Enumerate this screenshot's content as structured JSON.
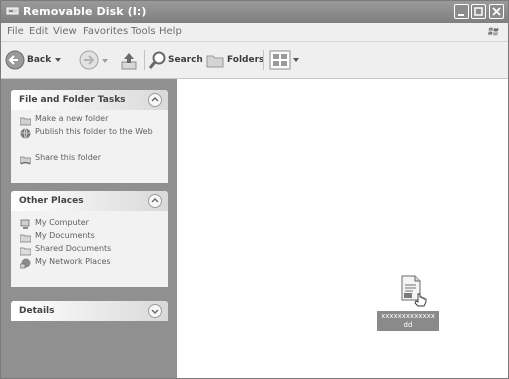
{
  "window": {
    "title": "Removable Disk (I:)"
  },
  "menu": {
    "items": [
      "File",
      "Edit",
      "View",
      "Favorites",
      "Tools",
      "Help"
    ]
  },
  "toolbar": {
    "back_label": "Back",
    "search_label": "Search",
    "folders_label": "Folders"
  },
  "tasks": {
    "title": "File and Folder Tasks",
    "items": [
      {
        "icon": "new-folder-icon",
        "label": "Make a new folder"
      },
      {
        "icon": "globe-icon",
        "label": "Publish this folder to the Web"
      },
      {
        "icon": "share-folder-icon",
        "label": "Share this folder"
      }
    ]
  },
  "other_places": {
    "title": "Other Places",
    "items": [
      {
        "icon": "computer-icon",
        "label": "My Computer"
      },
      {
        "icon": "documents-icon",
        "label": "My Documents"
      },
      {
        "icon": "shared-folder-icon",
        "label": "Shared Documents"
      },
      {
        "icon": "network-icon",
        "label": "My Network Places"
      }
    ]
  },
  "details": {
    "title": "Details"
  },
  "file": {
    "name_line1": "xxxxxxxxxxxxx",
    "name_line2": "dd"
  }
}
